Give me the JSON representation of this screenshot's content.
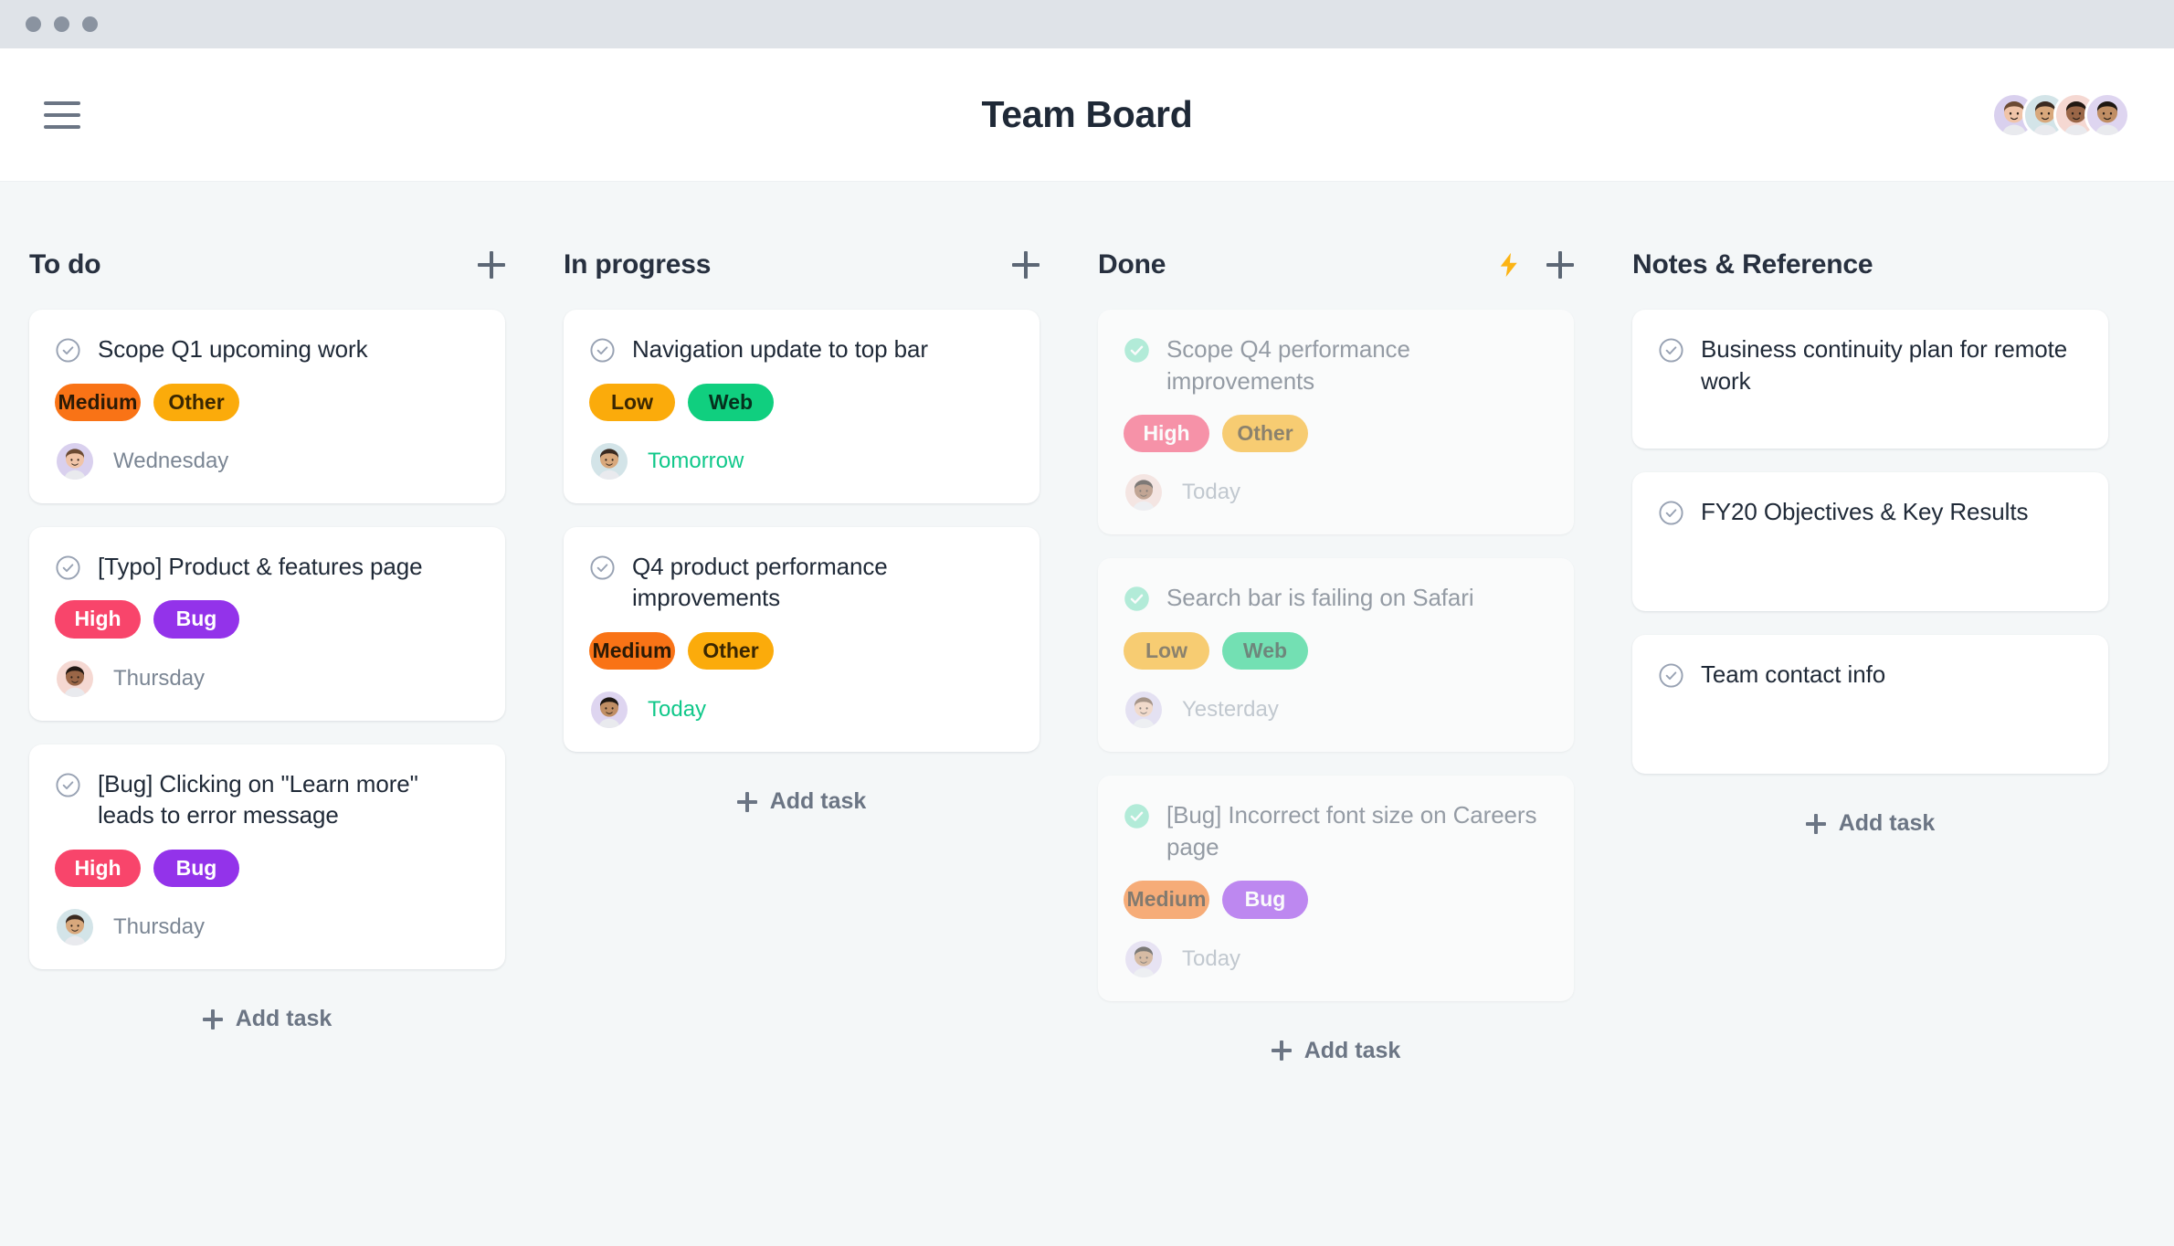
{
  "window": {
    "traffic_lights": [
      "close",
      "minimize",
      "maximize"
    ]
  },
  "header": {
    "title": "Team Board",
    "menu_icon": "hamburger-icon",
    "members": [
      {
        "name": "member-1",
        "bg": "#d9d0ee",
        "skin": "#f0c4a8",
        "hair": "#6b4a33"
      },
      {
        "name": "member-2",
        "bg": "#d3e4e8",
        "skin": "#d8a87c",
        "hair": "#3a2a20"
      },
      {
        "name": "member-3",
        "bg": "#f5d8d2",
        "skin": "#9a6647",
        "hair": "#221812"
      },
      {
        "name": "member-4",
        "bg": "#ded5f0",
        "skin": "#c08e64",
        "hair": "#1d1712"
      }
    ]
  },
  "tag_styles": {
    "Medium": {
      "bg": "#f97316",
      "fg": "#2b1a06"
    },
    "Other": {
      "bg": "#fbab0b",
      "fg": "#3a2702"
    },
    "High": {
      "bg": "#f8456b",
      "fg": "#ffffff"
    },
    "Bug": {
      "bg": "#9333ea",
      "fg": "#ffffff"
    },
    "Low": {
      "bg": "#fbab0b",
      "fg": "#3a2702"
    },
    "Web": {
      "bg": "#10cf7f",
      "fg": "#06301d"
    }
  },
  "accent_colors": {
    "due_soon": "#10c88a",
    "bolt": "#fcb415",
    "done_check": "#7fe3c0",
    "board_bg": "#f4f7f8",
    "titlebar": "#dfe3e8"
  },
  "add_task_label": "Add task",
  "columns": [
    {
      "name": "todo",
      "title": "To do",
      "has_bolt": false,
      "add_button_icon": "plus-icon",
      "show_add_task": true,
      "cards": [
        {
          "title": "Scope Q1 upcoming work",
          "state": "open",
          "tags": [
            "Medium",
            "Other"
          ],
          "date": "Wednesday",
          "date_accent": false,
          "avatar": {
            "bg": "#d9d0ee",
            "skin": "#f0c4a8",
            "hair": "#6b4a33"
          }
        },
        {
          "title": "[Typo] Product & features page",
          "state": "open",
          "tags": [
            "High",
            "Bug"
          ],
          "date": "Thursday",
          "date_accent": false,
          "avatar": {
            "bg": "#f5d8d2",
            "skin": "#9a6647",
            "hair": "#221812"
          }
        },
        {
          "title": "[Bug] Clicking on \"Learn more\" leads to error message",
          "state": "open",
          "tags": [
            "High",
            "Bug"
          ],
          "date": "Thursday",
          "date_accent": false,
          "avatar": {
            "bg": "#d3e4e8",
            "skin": "#d8a87c",
            "hair": "#3a2a20"
          }
        }
      ]
    },
    {
      "name": "in-progress",
      "title": "In progress",
      "has_bolt": false,
      "add_button_icon": "plus-icon",
      "show_add_task": true,
      "cards": [
        {
          "title": "Navigation update to top bar",
          "state": "open",
          "tags": [
            "Low",
            "Web"
          ],
          "date": "Tomorrow",
          "date_accent": true,
          "avatar": {
            "bg": "#d3e4e8",
            "skin": "#d8a87c",
            "hair": "#3a2a20"
          }
        },
        {
          "title": "Q4 product performance improvements",
          "state": "open",
          "tags": [
            "Medium",
            "Other"
          ],
          "date": "Today",
          "date_accent": true,
          "avatar": {
            "bg": "#ded5f0",
            "skin": "#c08e64",
            "hair": "#1d1712"
          }
        }
      ]
    },
    {
      "name": "done",
      "title": "Done",
      "has_bolt": true,
      "bolt_icon": "lightning-bolt-icon",
      "add_button_icon": "plus-icon",
      "show_add_task": true,
      "cards": [
        {
          "title": "Scope Q4 performance improvements",
          "state": "done",
          "tags": [
            "High",
            "Other"
          ],
          "date": "Today",
          "date_accent": false,
          "avatar": {
            "bg": "#f5d8d2",
            "skin": "#9a6647",
            "hair": "#221812"
          }
        },
        {
          "title": "Search bar is failing on Safari",
          "state": "done",
          "tags": [
            "Low",
            "Web"
          ],
          "date": "Yesterday",
          "date_accent": false,
          "avatar": {
            "bg": "#d9d0ee",
            "skin": "#f0c4a8",
            "hair": "#6b4a33"
          }
        },
        {
          "title": "[Bug] Incorrect font size on Careers page",
          "state": "done",
          "tags": [
            "Medium",
            "Bug"
          ],
          "date": "Today",
          "date_accent": false,
          "avatar": {
            "bg": "#ded5f0",
            "skin": "#c08e64",
            "hair": "#1d1712"
          }
        }
      ]
    },
    {
      "name": "notes",
      "title": "Notes & Reference",
      "has_bolt": false,
      "add_button_icon": null,
      "show_add_task": true,
      "cards": [
        {
          "title": "Business continuity plan for remote work",
          "state": "open",
          "tags": [],
          "date": null,
          "date_accent": false,
          "avatar": null
        },
        {
          "title": "FY20 Objectives & Key Results",
          "state": "open",
          "tags": [],
          "date": null,
          "date_accent": false,
          "avatar": null
        },
        {
          "title": "Team contact info",
          "state": "open",
          "tags": [],
          "date": null,
          "date_accent": false,
          "avatar": null
        }
      ]
    }
  ]
}
